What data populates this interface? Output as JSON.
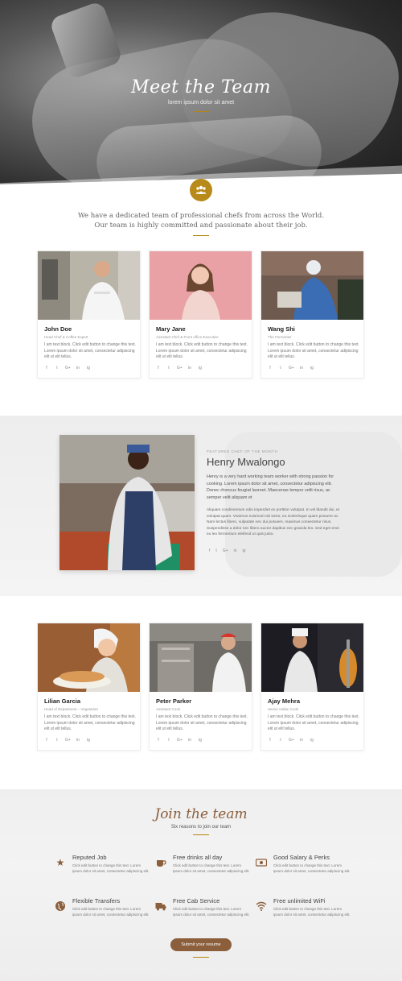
{
  "hero": {
    "title": "Meet the Team",
    "subtitle": "lorem ipsum dolor sit amet"
  },
  "intro": {
    "line1": "We have a dedicated team of professional chefs from across the World.",
    "line2": "Our team is highly committed and passionate about their job."
  },
  "social_icons": [
    "f",
    "t",
    "G+",
    "in",
    "ig"
  ],
  "team_top": [
    {
      "name": "John Doe",
      "role": "Head Chef & Coffee Expert",
      "bio": "I am text block. Click edit button to change this text. Lorem ipsum dolor sit amet, consectetur adipiscing elit ut elit tellus."
    },
    {
      "name": "Mary Jane",
      "role": "Assistant Chef & Front office Executive",
      "bio": "I am text block. Click edit button to change this text. Lorem ipsum dolor sit amet, consectetur adipiscing elit ut elit tellus."
    },
    {
      "name": "Wang Shi",
      "role": "The Fermenter",
      "bio": "I am text block. Click edit button to change this text. Lorem ipsum dolor sit amet, consectetur adipiscing elit ut elit tellus."
    }
  ],
  "featured": {
    "label": "FEATURED CHEF OF THE MONTH",
    "name": "Henry Mwalongo",
    "bio1": "Henry is a very hard working team worker with strong passion for cooking. Lorem ipsum dolor sit amet, consectetur adipiscing elit. Donec rhoncus feugiat laoreet. Maecenas tempor velit risus, ac semper velit aliquam et",
    "bio2": "Aliquam condimentum odio imperdiet ex porttitor volutpat. In vel blandit dui, et volutpat quam. Vivamus euismod nisi tortor, eu scelerisque quam posuere ac. Nam lectus libero, vulputate nec dui posuere, maximus consectetur risus. Suspendisse a dolor nec libero auctor dapibus nec gravida leo. Sed eget eros eu leo fermentum eleifend ut quis justo."
  },
  "team_bottom": [
    {
      "name": "Lilian Garcia",
      "role": "Head of Department – Vegetarian",
      "bio": "I am text block. Click edit button to change this text. Lorem ipsum dolor sit amet, consectetur adipiscing elit ut elit tellus."
    },
    {
      "name": "Peter Parker",
      "role": "Assistant Cook",
      "bio": "I am text block. Click edit button to change this text. Lorem ipsum dolor sit amet, consectetur adipiscing elit ut elit tellus."
    },
    {
      "name": "Ajay Mehra",
      "role": "Senior Indian Cook",
      "bio": "I am text block. Click edit button to change this text. Lorem ipsum dolor sit amet, consectetur adipiscing elit ut elit tellus."
    }
  ],
  "join": {
    "title": "Join the team",
    "subtitle": "Six reasons to join our team",
    "reasons": [
      {
        "title": "Reputed Job",
        "text": "Click edit button to change this text. Lorem ipsum dolor sit amet, consectetur adipiscing elit.",
        "icon": "star-icon"
      },
      {
        "title": "Free drinks all day",
        "text": "Click edit button to change this text. Lorem ipsum dolor sit amet, consectetur adipiscing elit.",
        "icon": "coffee-cup-icon"
      },
      {
        "title": "Good Salary & Perks",
        "text": "Click edit button to change this text. Lorem ipsum dolor sit amet, consectetur adipiscing elit.",
        "icon": "money-bill-icon"
      },
      {
        "title": "Flexible Transfers",
        "text": "Click edit button to change this text. Lorem ipsum dolor sit amet, consectetur adipiscing elit.",
        "icon": "globe-icon"
      },
      {
        "title": "Free Cab Service",
        "text": "Click edit button to change this text. Lorem ipsum dolor sit amet, consectetur adipiscing elit.",
        "icon": "truck-icon"
      },
      {
        "title": "Free unlimited WiFi",
        "text": "Click edit button to change this text. Lorem ipsum dolor sit amet, consectetur adipiscing elit.",
        "icon": "wifi-icon"
      }
    ],
    "button_label": "Submit your resume"
  },
  "colors": {
    "accent_gold": "#b88a1a",
    "accent_brown": "#8b5e3c"
  }
}
